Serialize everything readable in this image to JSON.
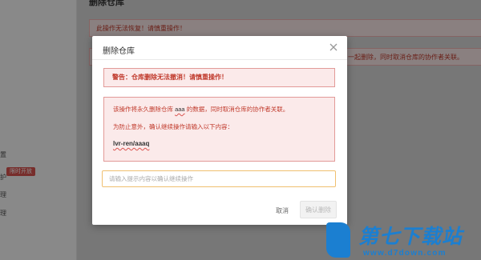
{
  "page": {
    "title": "删除仓库"
  },
  "background": {
    "alert1": "此操作无法恢复！请慎重操作！",
    "alert2_tail": "一起删除，同时取消仓库的协作者关联。"
  },
  "sidebar": {
    "items": [
      {
        "label": "置"
      },
      {
        "label": "护"
      },
      {
        "label": "理"
      },
      {
        "label": "理"
      }
    ],
    "badge": "限时开放"
  },
  "modal": {
    "title": "删除仓库",
    "warning": "警告：仓库删除无法撤消！请慎重操作！",
    "info": {
      "line1_prefix": "该操作将永久删除仓库",
      "repo_name": "aaa",
      "line1_suffix": "的数据，同时取消仓库的协作者关联。",
      "line2": "为防止意外，确认继续操作请输入以下内容：",
      "repo_path": "lvr-ren/aaaq"
    },
    "input": {
      "placeholder": "请输入提示内容以确认继续操作",
      "value": ""
    },
    "buttons": {
      "cancel": "取消",
      "confirm": "确认删除"
    }
  },
  "watermark": {
    "brand": "第七下载站",
    "url": "www.d7down.com"
  },
  "colors": {
    "danger_text": "#c0392b",
    "danger_bg": "#fbeaea",
    "danger_border": "#e29a98",
    "input_focus_border": "#f0c070",
    "watermark_blue": "#1b7fd1"
  }
}
